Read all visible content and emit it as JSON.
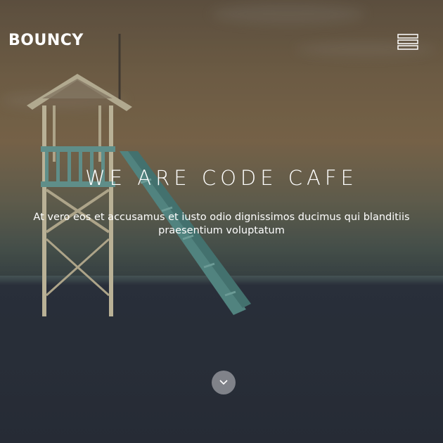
{
  "header": {
    "logo_text": "BOUNCY",
    "menu_icon": "hamburger-menu-icon"
  },
  "hero": {
    "headline": "WE ARE CODE CAFE",
    "tagline": "At vero eos et accusamus et iusto odio dignissimos ducimus qui blanditiis praesentium voluptatum",
    "scroll_icon": "chevron-down-icon"
  },
  "colors": {
    "text": "#ffffff",
    "sea_bottom": "#2a2f3a",
    "scroll_button_bg": "#c8c8cd"
  }
}
